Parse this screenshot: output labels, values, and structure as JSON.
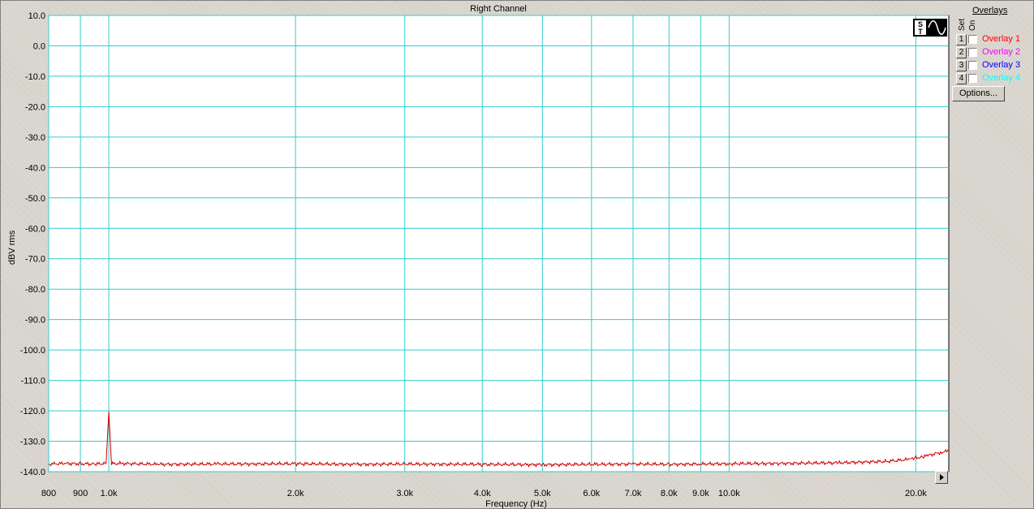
{
  "chart_data": {
    "type": "line",
    "title": "Right Channel",
    "xlabel": "Frequency (Hz)",
    "ylabel": "dBV rms",
    "x_scale": "log",
    "xlim": [
      800,
      22600
    ],
    "ylim": [
      -140,
      10
    ],
    "yticks": [
      10,
      0,
      -10,
      -20,
      -30,
      -40,
      -50,
      -60,
      -70,
      -80,
      -90,
      -100,
      -110,
      -120,
      -130,
      -140
    ],
    "ytick_labels": [
      "10.0",
      "0.0",
      "-10.0",
      "-20.0",
      "-30.0",
      "-40.0",
      "-50.0",
      "-60.0",
      "-70.0",
      "-80.0",
      "-90.0",
      "-100.0",
      "-110.0",
      "-120.0",
      "-130.0",
      "-140.0"
    ],
    "xticks": [
      800,
      900,
      1000,
      2000,
      3000,
      4000,
      5000,
      6000,
      7000,
      8000,
      9000,
      10000,
      20000
    ],
    "xtick_labels": [
      "800",
      "900",
      "1.0k",
      "2.0k",
      "3.0k",
      "4.0k",
      "5.0k",
      "6.0k",
      "7.0k",
      "8.0k",
      "9.0k",
      "10.0k",
      "20.0k"
    ],
    "grid": true,
    "series": [
      {
        "color": "#cc0000",
        "x": [
          800,
          850,
          900,
          950,
          990,
          1000,
          1010,
          1050,
          1200,
          1500,
          2000,
          2500,
          3000,
          4000,
          5000,
          6000,
          7000,
          8000,
          9000,
          10000,
          12000,
          15000,
          18000,
          19500,
          20000,
          20500,
          21000,
          22000,
          22600
        ],
        "y": [
          -137.5,
          -137.3,
          -137.4,
          -137.5,
          -137.3,
          -120.3,
          -137.4,
          -137.3,
          -137.6,
          -137.5,
          -137.4,
          -137.6,
          -137.5,
          -137.6,
          -137.7,
          -137.6,
          -137.5,
          -137.6,
          -137.5,
          -137.4,
          -137.3,
          -137.1,
          -136.6,
          -136.0,
          -135.4,
          -135.2,
          -134.6,
          -133.6,
          -133.2
        ]
      }
    ]
  },
  "overlays": {
    "header": "Overlays",
    "set_label": "Set",
    "on_label": "On",
    "items": [
      {
        "number": "1",
        "label": "Overlay 1",
        "color": "#ff0000"
      },
      {
        "number": "2",
        "label": "Overlay 2",
        "color": "#ff00ff"
      },
      {
        "number": "3",
        "label": "Overlay 3",
        "color": "#0000ff"
      },
      {
        "number": "4",
        "label": "Overlay 4",
        "color": "#00ffff"
      }
    ],
    "options_label": "Options..."
  },
  "colors": {
    "plot_bg": "#ffffff",
    "grid": "#33cccc",
    "trace": "#cc0000"
  }
}
